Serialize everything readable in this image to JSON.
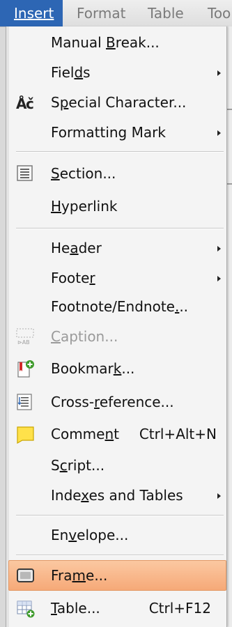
{
  "menubar": {
    "items": [
      {
        "label": "Insert",
        "u": 0
      },
      {
        "label": "Format",
        "u": 0
      },
      {
        "label": "Table",
        "u": 1
      },
      {
        "label": "Too",
        "u": 0
      }
    ]
  },
  "menu": {
    "manual_break": {
      "pre": "Manual ",
      "u": "B",
      "post": "reak..."
    },
    "fields": {
      "pre": "Fiel",
      "u": "d",
      "post": "s"
    },
    "special_character": {
      "pre": "S",
      "u": "p",
      "post": "ecial Character..."
    },
    "formatting_mark": {
      "pre": "Formatting Mark",
      "u": "",
      "post": ""
    },
    "section": {
      "pre": "",
      "u": "S",
      "post": "ection..."
    },
    "hyperlink": {
      "pre": "",
      "u": "H",
      "post": "yperlink"
    },
    "header": {
      "pre": "He",
      "u": "a",
      "post": "der"
    },
    "footer": {
      "pre": "Foote",
      "u": "r",
      "post": ""
    },
    "footnote": {
      "pre": "Footnote/Endnote",
      "u": ".",
      "post": ".."
    },
    "caption": {
      "pre": "",
      "u": "C",
      "post": "aption..."
    },
    "bookmark": {
      "pre": "Bookmar",
      "u": "k",
      "post": "..."
    },
    "cross_reference": {
      "pre": "Cross-",
      "u": "r",
      "post": "eference..."
    },
    "comment": {
      "pre": "Comme",
      "u": "n",
      "post": "t",
      "shortcut": "Ctrl+Alt+N"
    },
    "script": {
      "pre": "S",
      "u": "c",
      "post": "ript..."
    },
    "indexes_tables": {
      "pre": "Inde",
      "u": "x",
      "post": "es and Tables"
    },
    "envelope": {
      "pre": "En",
      "u": "v",
      "post": "elope..."
    },
    "frame": {
      "pre": "Fra",
      "u": "m",
      "post": "e..."
    },
    "table": {
      "pre": "",
      "u": "T",
      "post": "able...",
      "shortcut": "Ctrl+F12"
    }
  },
  "icons": {
    "special_character": "special-character-icon",
    "section": "section-icon",
    "caption": "caption-icon",
    "bookmark": "bookmark-icon",
    "cross_reference": "cross-reference-icon",
    "comment": "comment-icon",
    "frame": "frame-icon",
    "table": "table-icon"
  },
  "colors": {
    "menubar_active": "#2d66b4",
    "highlight": "#f6a978",
    "disabled_text": "#9a9a9a"
  }
}
